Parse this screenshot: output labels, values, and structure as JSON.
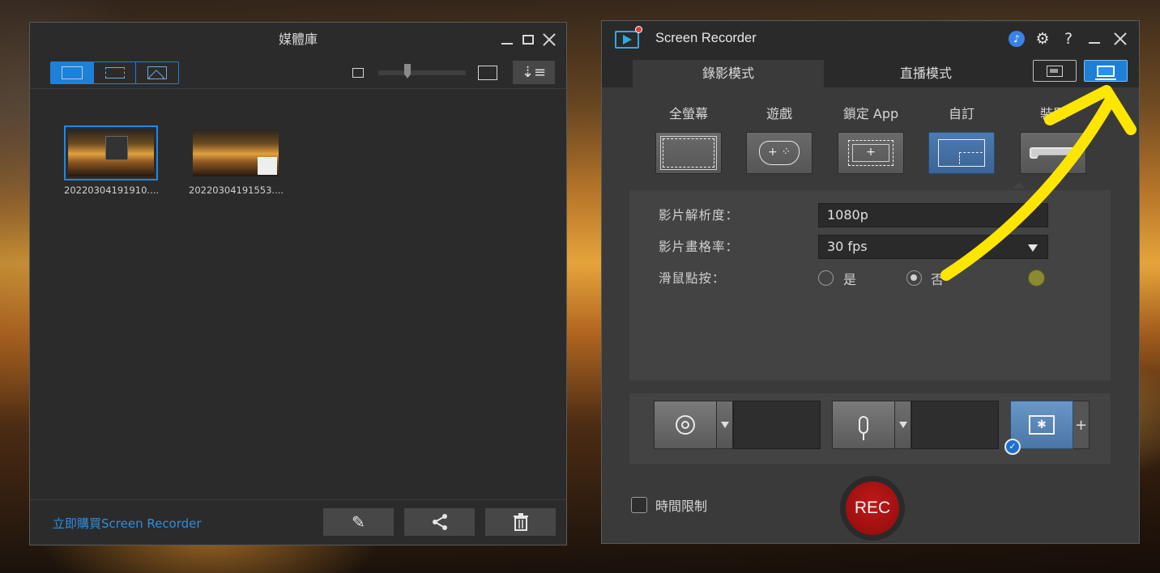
{
  "colors": {
    "accent": "#1e80d6",
    "rec_red": "#b01414",
    "annotation_arrow": "#ffe600"
  },
  "library": {
    "title": "媒體庫",
    "view_modes": [
      "all-media-icon",
      "video-icon",
      "image-icon"
    ],
    "thumbnails": [
      {
        "name": "20220304191910....",
        "selected": true
      },
      {
        "name": "20220304191553....",
        "selected": false
      }
    ],
    "buy_link": "立即購買Screen Recorder",
    "footer_buttons": [
      "pencil-icon",
      "share-icon",
      "trash-icon"
    ]
  },
  "recorder": {
    "title": "Screen Recorder",
    "help": "?",
    "tabs": {
      "record": "錄影模式",
      "live": "直播模式"
    },
    "modes": [
      {
        "label": "全螢幕",
        "active": false
      },
      {
        "label": "遊戲",
        "active": false
      },
      {
        "label": "鎖定 App",
        "active": false
      },
      {
        "label": "自訂",
        "active": true
      },
      {
        "label": "裝置",
        "active": false
      }
    ],
    "settings": {
      "resolution_label": "影片解析度：",
      "resolution_value": "1080p",
      "framerate_label": "影片畫格率：",
      "framerate_value": "30 fps",
      "mouse_label": "滑鼠點按：",
      "mouse_yes": "是",
      "mouse_no": "否",
      "mouse_selected": "否"
    },
    "inputs": {
      "fx_add": "+",
      "fx_checked": "✓"
    },
    "time_limit": "時間限制",
    "rec_button": "REC"
  }
}
